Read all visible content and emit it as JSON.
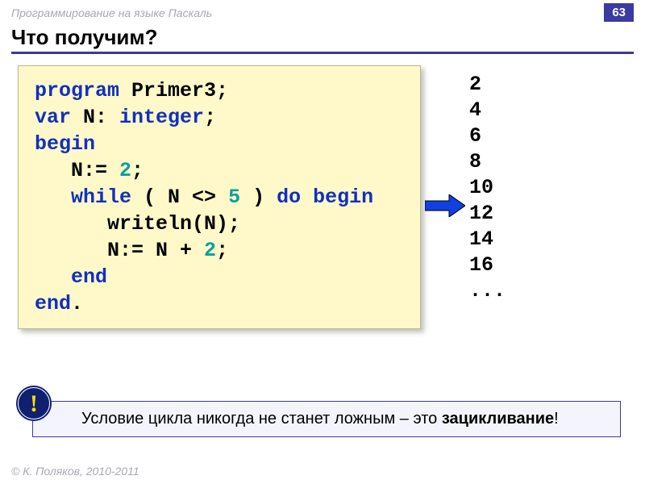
{
  "header": {
    "subject": "Программирование на языке Паскаль",
    "page": "63"
  },
  "title": "Что получим?",
  "code": {
    "line1_kw1": "program",
    "line1_name": " Primer3;",
    "line2_kw1": "var",
    "line2_mid": " N: ",
    "line2_kw2": "integer",
    "line2_end": ";",
    "line3_kw": "begin",
    "line4_pre": "   N:= ",
    "line4_num": "2",
    "line4_post": ";",
    "line5_pre": "   ",
    "line5_kw1": "while",
    "line5_mid1": " ( N <> ",
    "line5_num": "5",
    "line5_mid2": " ) ",
    "line5_kw2": "do begin",
    "line6": "      writeln(N);",
    "line7_pre": "      N:= N + ",
    "line7_num": "2",
    "line7_post": ";",
    "line8_pre": "   ",
    "line8_kw": "end",
    "line9_kw": "end",
    "line9_post": "."
  },
  "output": {
    "l1": "2",
    "l2": "4",
    "l3": "6",
    "l4": "8",
    "l5": "10",
    "l6": "12",
    "l7": "14",
    "l8": "16",
    "l9": "..."
  },
  "note": {
    "pre": "Условие цикла никогда не станет ложным – это ",
    "term": "зацикливание",
    "post": "!"
  },
  "footer": "© К. Поляков, 2010-2011"
}
